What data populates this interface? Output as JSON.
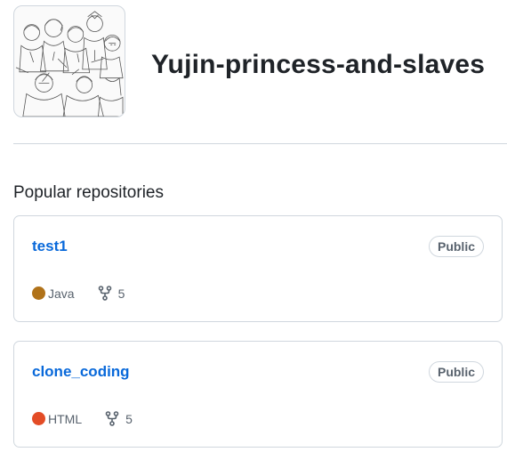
{
  "org": {
    "name": "Yujin-princess-and-slaves",
    "avatar_icon": "group-illustration-avatar"
  },
  "section": {
    "title": "Popular repositories"
  },
  "repos": [
    {
      "name": "test1",
      "visibility": "Public",
      "language": "Java",
      "language_color": "#b07219",
      "forks": "5"
    },
    {
      "name": "clone_coding",
      "visibility": "Public",
      "language": "HTML",
      "language_color": "#e34c26",
      "forks": "5"
    }
  ],
  "colors": {
    "link": "#0969da",
    "border": "#d0d7de",
    "muted": "#59636e"
  }
}
